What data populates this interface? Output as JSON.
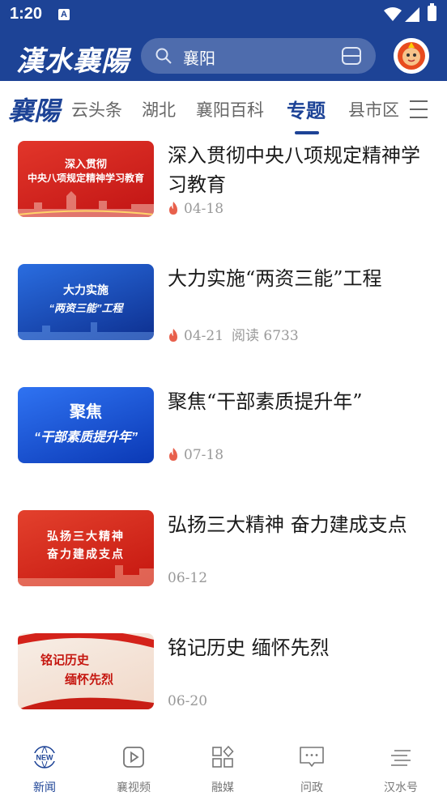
{
  "status_bar": {
    "time": "1:20",
    "a_badge": "A"
  },
  "header": {
    "logo": "漢水襄陽",
    "search_value": "襄阳"
  },
  "tabs": {
    "brand": "襄陽",
    "items": [
      {
        "label": "云头条"
      },
      {
        "label": "湖北"
      },
      {
        "label": "襄阳百科"
      },
      {
        "label": "专题"
      },
      {
        "label": "县市区"
      }
    ],
    "active": "专题"
  },
  "articles": [
    {
      "title": "深入贯彻中央八项规定精神学习教育",
      "date": "04-18",
      "hot": true,
      "reads": "",
      "thumb_lines": [
        "深入贯彻",
        "中央八项规定精神学习教育"
      ]
    },
    {
      "title": "大力实施“两资三能”工程",
      "date": "04-21",
      "hot": true,
      "reads": "阅读 6733",
      "thumb_lines": [
        "大力实施",
        "“两资三能”工程"
      ]
    },
    {
      "title": "聚焦“干部素质提升年”",
      "date": "07-18",
      "hot": true,
      "reads": "",
      "thumb_lines": [
        "聚焦",
        "“干部素质提升年”"
      ]
    },
    {
      "title": "弘扬三大精神 奋力建成支点",
      "date": "06-12",
      "hot": false,
      "reads": "",
      "thumb_lines": [
        "弘扬三大精神",
        "奋力建成支点"
      ]
    },
    {
      "title": "铭记历史 缅怀先烈",
      "date": "06-20",
      "hot": false,
      "reads": "",
      "thumb_lines": [
        "铭记历史",
        "缅怀先烈"
      ]
    }
  ],
  "bottom_nav": [
    {
      "label": "新闻",
      "icon": "news-icon",
      "active": true
    },
    {
      "label": "襄视频",
      "icon": "video-icon",
      "active": false
    },
    {
      "label": "融媒",
      "icon": "grid-icon",
      "active": false
    },
    {
      "label": "问政",
      "icon": "chat-icon",
      "active": false
    },
    {
      "label": "汉水号",
      "icon": "lines-icon",
      "active": false
    }
  ],
  "colors": {
    "brand_blue": "#1d4396",
    "hot_red": "#e8604c",
    "thumb_red": "#d8231c",
    "thumb_blue": "#1a4fc8"
  }
}
